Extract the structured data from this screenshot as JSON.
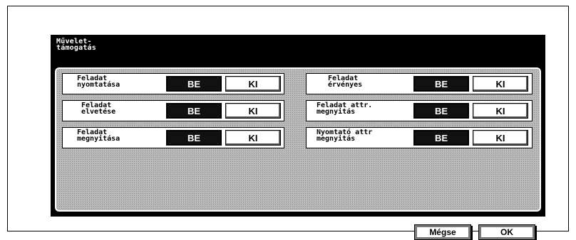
{
  "screen": {
    "title": "Művelet-\ntámogatás"
  },
  "settings": [
    {
      "label": "Feladat\nnyomtatása",
      "on": "BE",
      "off": "KI",
      "selected": "BE"
    },
    {
      "label": "Feladat\nelvetése",
      "on": "BE",
      "off": "KI",
      "selected": "BE"
    },
    {
      "label": "Feladat\nmegnyitása",
      "on": "BE",
      "off": "KI",
      "selected": "BE"
    },
    {
      "label": "Feladat\nérvényes",
      "on": "BE",
      "off": "KI",
      "selected": "BE"
    },
    {
      "label": "Feladat attr.\nmegnyitás",
      "on": "BE",
      "off": "KI",
      "selected": "BE"
    },
    {
      "label": "Nyomtató attr\nmegnyitás",
      "on": "BE",
      "off": "KI",
      "selected": "BE"
    }
  ],
  "footer": {
    "cancel_label": "Mégse",
    "ok_label": "OK"
  }
}
